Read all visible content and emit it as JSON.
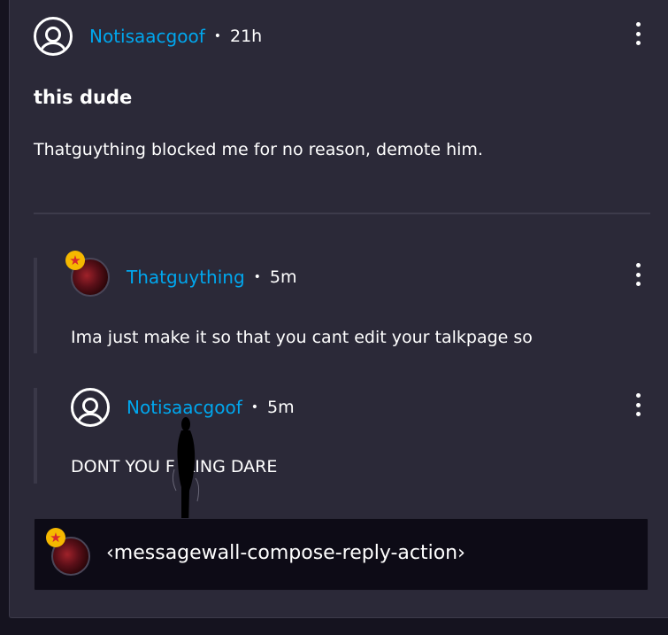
{
  "thread": {
    "author": "Notisaacgoof",
    "separator": "•",
    "time": "21h",
    "title": "this dude",
    "body": "Thatguything blocked me for no reason, demote him."
  },
  "replies": [
    {
      "author": "Thatguything",
      "separator": "•",
      "time": "5m",
      "body": "Ima just make it so that you cant edit your talkpage so",
      "badge_icon": "star-icon"
    },
    {
      "author": "Notisaacgoof",
      "separator": "•",
      "time": "5m",
      "body_start": "DONT YOU F",
      "body_end": "KING DARE"
    }
  ],
  "compose": {
    "placeholder": "‹messagewall-compose-reply-action›"
  },
  "colors": {
    "background": "#15131f",
    "card": "#2b2938",
    "link": "#00a7ee",
    "compose_bg": "#0d0b16",
    "badge": "#f5b800"
  }
}
